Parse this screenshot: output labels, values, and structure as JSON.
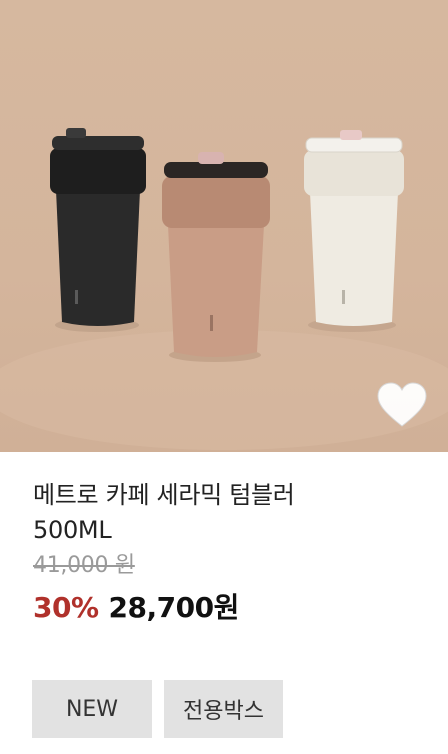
{
  "product": {
    "image_alt_icon": "tumbler-product-photo",
    "title_line1": "메트로 카페 세라믹 텀블러",
    "title_line2": "500ML",
    "original_price": "41,000 원",
    "discount": "30%",
    "sale_price": "28,700원",
    "wishlist_icon": "heart-icon",
    "badges": [
      "NEW",
      "전용박스"
    ]
  },
  "colors": {
    "background": "#d5b79e",
    "discount": "#b0312b",
    "badge_bg": "#e2e2e2"
  }
}
